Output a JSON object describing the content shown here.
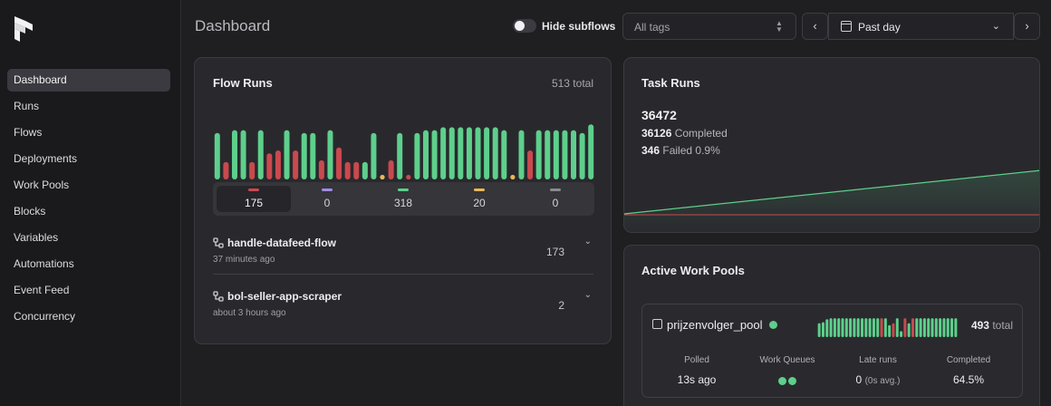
{
  "nav": {
    "items": [
      "Dashboard",
      "Runs",
      "Flows",
      "Deployments",
      "Work Pools",
      "Blocks",
      "Variables",
      "Automations",
      "Event Feed",
      "Concurrency"
    ],
    "active": "Dashboard"
  },
  "header": {
    "title": "Dashboard",
    "hide_subflows_label": "Hide subflows",
    "hide_subflows_on": false,
    "tags_placeholder": "All tags",
    "date_range": "Past day"
  },
  "colors": {
    "completed": "#5ecf8c",
    "failed": "#c9494e",
    "running": "#9f8ce6",
    "late": "#e8b857",
    "other": "#8a8a90"
  },
  "flow_runs": {
    "title": "Flow Runs",
    "total_label": "513 total",
    "states": [
      {
        "key": "failed",
        "count": "175"
      },
      {
        "key": "running",
        "count": "0"
      },
      {
        "key": "completed",
        "count": "318"
      },
      {
        "key": "late",
        "count": "20"
      },
      {
        "key": "other",
        "count": "0"
      }
    ],
    "runs": [
      {
        "name": "handle-datafeed-flow",
        "time": "37 minutes ago",
        "count": "173"
      },
      {
        "name": "bol-seller-app-scraper",
        "time": "about 3 hours ago",
        "count": "2"
      }
    ]
  },
  "chart_data": {
    "type": "bar",
    "series_states": [
      "completed",
      "failed",
      "completed",
      "completed",
      "failed",
      "completed",
      "failed",
      "failed",
      "completed",
      "failed",
      "completed",
      "completed",
      "failed",
      "completed",
      "failed",
      "failed",
      "failed",
      "completed",
      "completed",
      "late",
      "failed",
      "completed",
      "dot-red",
      "completed",
      "completed",
      "completed",
      "completed",
      "completed",
      "completed",
      "completed",
      "completed",
      "completed",
      "completed",
      "completed",
      "late",
      "completed",
      "failed",
      "completed",
      "completed",
      "completed",
      "completed",
      "completed",
      "completed",
      "completed"
    ],
    "values": [
      0.8,
      0.3,
      0.85,
      0.85,
      0.3,
      0.85,
      0.45,
      0.5,
      0.85,
      0.5,
      0.8,
      0.8,
      0.33,
      0.85,
      0.55,
      0.3,
      0.3,
      0.3,
      0.8,
      0.1,
      0.33,
      0.8,
      0.12,
      0.8,
      0.85,
      0.85,
      0.9,
      0.9,
      0.9,
      0.9,
      0.9,
      0.9,
      0.9,
      0.85,
      0.12,
      0.85,
      0.5,
      0.85,
      0.85,
      0.85,
      0.85,
      0.85,
      0.8,
      0.95
    ]
  },
  "task_runs": {
    "title": "Task Runs",
    "total": "36472",
    "completed_count": "36126",
    "completed_label": "Completed",
    "failed_count": "346",
    "failed_label": "Failed 0.9%"
  },
  "work_pools": {
    "title": "Active Work Pools",
    "pool": {
      "name": "prijzenvolger_pool",
      "total_count": "493",
      "total_label": "total",
      "bar_states": [
        "completed",
        "completed",
        "completed",
        "completed",
        "completed",
        "completed",
        "completed",
        "completed",
        "completed",
        "completed",
        "completed",
        "completed",
        "completed",
        "completed",
        "completed",
        "completed",
        "failed",
        "completed",
        "completed",
        "failed",
        "completed",
        "completed",
        "failed",
        "completed",
        "failed",
        "completed",
        "completed",
        "completed",
        "completed",
        "completed",
        "completed",
        "completed",
        "completed",
        "completed",
        "completed",
        "completed"
      ],
      "bar_values": [
        0.7,
        0.75,
        0.9,
        0.95,
        0.95,
        0.95,
        0.95,
        0.95,
        0.95,
        0.95,
        0.95,
        0.95,
        0.95,
        0.95,
        0.95,
        0.95,
        0.95,
        0.95,
        0.6,
        0.7,
        0.95,
        0.3,
        0.95,
        0.7,
        0.95,
        0.95,
        0.95,
        0.95,
        0.95,
        0.95,
        0.95,
        0.95,
        0.95,
        0.95,
        0.95,
        0.95
      ],
      "stats": [
        {
          "label": "Polled",
          "value": "13s ago"
        },
        {
          "label": "Work Queues",
          "value": ""
        },
        {
          "label": "Late runs",
          "value": "0",
          "sub": "(0s avg.)"
        },
        {
          "label": "Completed",
          "value": "64.5%"
        }
      ]
    }
  }
}
